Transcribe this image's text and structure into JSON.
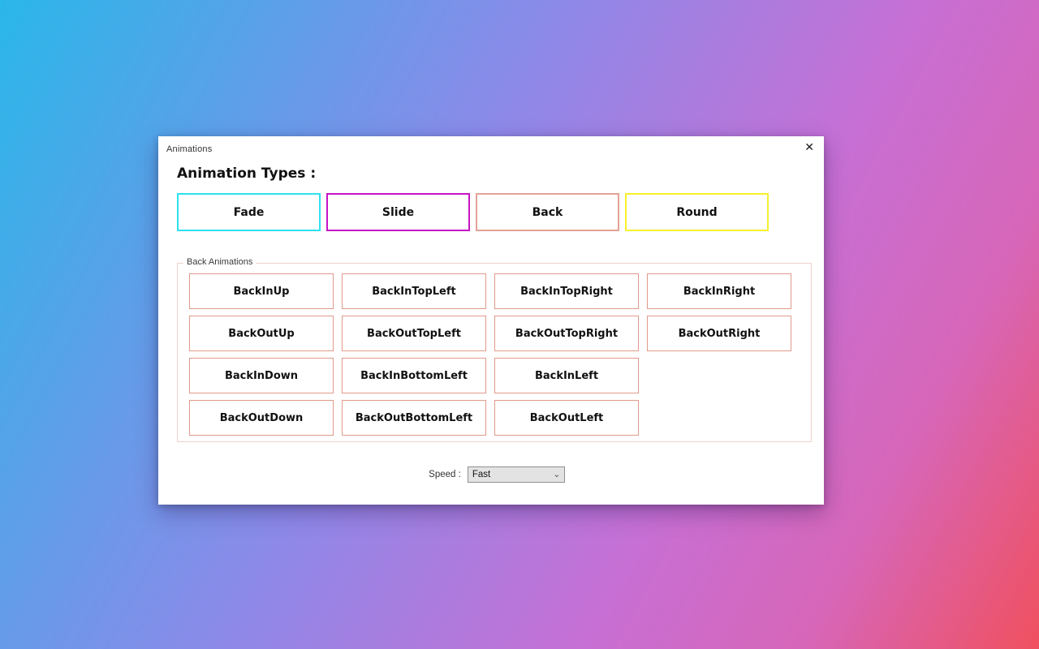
{
  "window": {
    "title": "Animations",
    "close_glyph": "✕"
  },
  "heading": "Animation Types :",
  "type_buttons": [
    {
      "label": "Fade",
      "border_color": "#2fe1ef"
    },
    {
      "label": "Slide",
      "border_color": "#c713c7"
    },
    {
      "label": "Back",
      "border_color": "#e5a294"
    },
    {
      "label": "Round",
      "border_color": "#f6f02e"
    }
  ],
  "group": {
    "label": "Back Animations",
    "button_border_color": "#e09a8b",
    "buttons": [
      "BackInUp",
      "BackInTopLeft",
      "BackInTopRight",
      "BackInRight",
      "BackOutUp",
      "BackOutTopLeft",
      "BackOutTopRight",
      "BackOutRight",
      "BackInDown",
      "BackInBottomLeft",
      "BackInLeft",
      "BackOutDown",
      "BackOutBottomLeft",
      "BackOutLeft"
    ]
  },
  "speed": {
    "label": "Speed :",
    "value": "Fast",
    "chevron_glyph": "⌄"
  }
}
